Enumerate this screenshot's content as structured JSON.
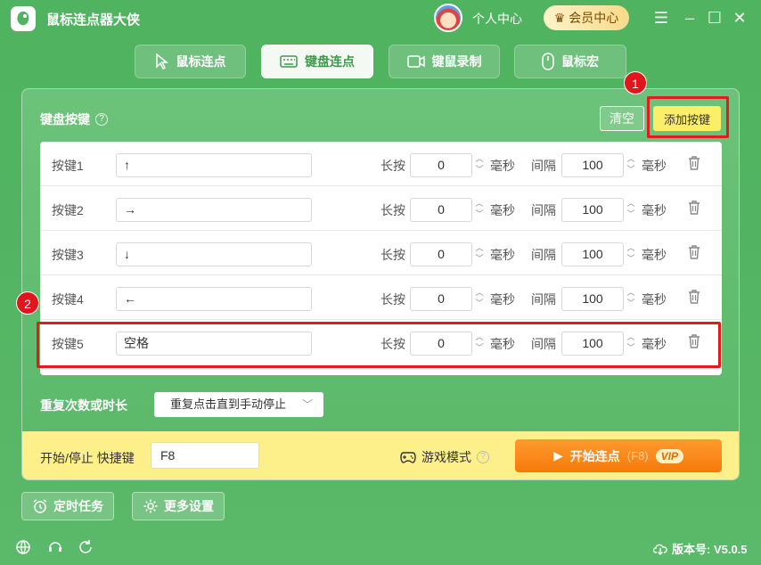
{
  "app": {
    "title": "鼠标连点器大侠",
    "user_center": "个人中心",
    "vip_center": "会员中心"
  },
  "tabs": [
    {
      "label": "鼠标连点",
      "icon": "cursor-icon",
      "active": false
    },
    {
      "label": "键盘连点",
      "icon": "keyboard-icon",
      "active": true
    },
    {
      "label": "键鼠录制",
      "icon": "video-icon",
      "active": false
    },
    {
      "label": "鼠标宏",
      "icon": "mouse-icon",
      "active": false
    }
  ],
  "keyboard": {
    "section_title": "键盘按键",
    "clear_label": "清空",
    "add_label": "添加按键",
    "hold_label": "长按",
    "interval_label": "间隔",
    "unit_ms": "毫秒",
    "keys": [
      {
        "label": "按键1",
        "key": "↑",
        "hold": "0",
        "interval": "100"
      },
      {
        "label": "按键2",
        "key": "→",
        "hold": "0",
        "interval": "100"
      },
      {
        "label": "按键3",
        "key": "↓",
        "hold": "0",
        "interval": "100"
      },
      {
        "label": "按键4",
        "key": "←",
        "hold": "0",
        "interval": "100"
      },
      {
        "label": "按键5",
        "key": "空格",
        "hold": "0",
        "interval": "100"
      }
    ]
  },
  "repeat": {
    "label": "重复次数或时长",
    "selected": "重复点击直到手动停止"
  },
  "control": {
    "hotkey_label": "开始/停止 快捷键",
    "hotkey_value": "F8",
    "game_mode_label": "游戏模式",
    "start_label": "开始连点",
    "start_shortcut": "(F8)",
    "vip_tag": "VIP"
  },
  "footer": {
    "timer_label": "定时任务",
    "settings_label": "更多设置",
    "version": "版本号: V5.0.5"
  },
  "annotations": {
    "step1": "1",
    "step2": "2"
  },
  "colors": {
    "accent_green": "#52b462",
    "highlight_red": "#e21c1c",
    "start_orange": "#f57a0a",
    "bar_yellow": "#fdf08a"
  }
}
